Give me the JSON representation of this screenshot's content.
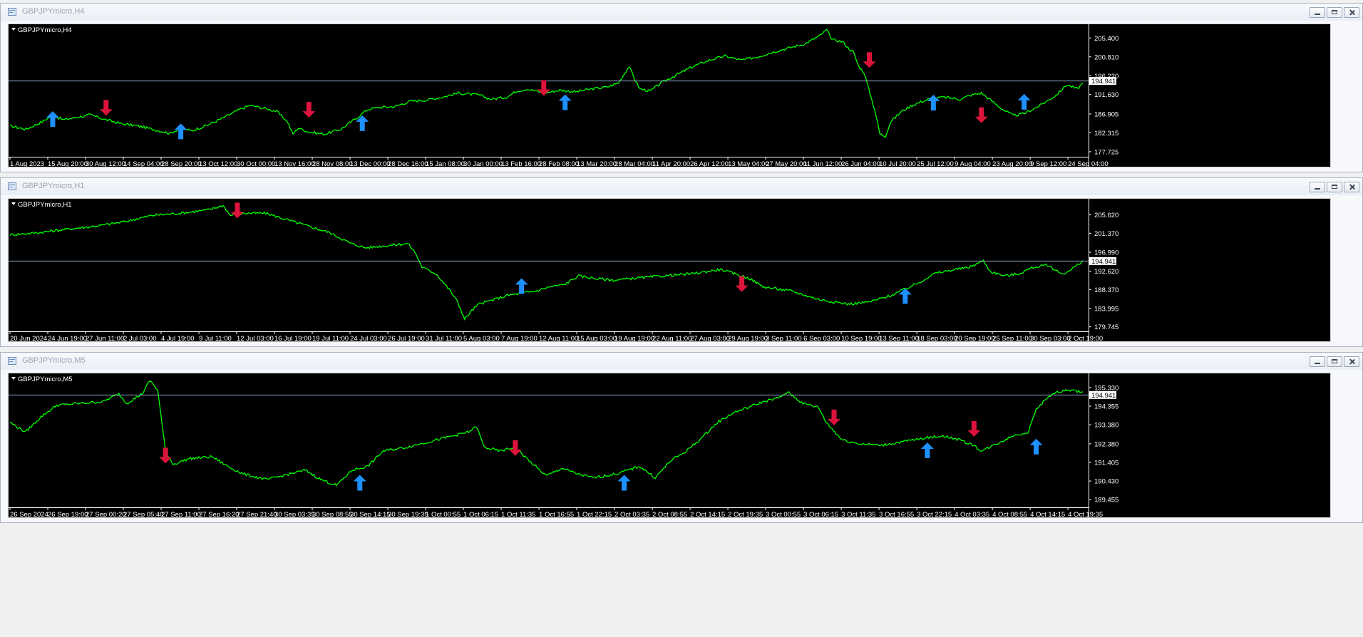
{
  "colors": {
    "background": "#000000",
    "price_line": "#00ff00",
    "axis_text": "#ffffff",
    "current_price_line": "#8fa8c8",
    "up_arrow": "#1e90ff",
    "down_arrow": "#dc143c"
  },
  "windows": [
    {
      "title": "GBPJPYmicro,H4",
      "chart_label": "GBPJPYmicro,H4",
      "current_price": "194.941",
      "price_ticks": [
        "205.400",
        "200.810",
        "196.220",
        "191.630",
        "186.905",
        "182.315",
        "177.725"
      ],
      "time_labels": [
        "1 Aug 2023",
        "15 Aug 20:00",
        "30 Aug 12:00",
        "14 Sep 04:00",
        "28 Sep 20:00",
        "13 Oct 12:00",
        "30 Oct 00:00",
        "13 Nov 16:00",
        "28 Nov 08:00",
        "13 Dec 00:00",
        "28 Dec 16:00",
        "15 Jan 08:00",
        "30 Jan 00:00",
        "13 Feb 16:00",
        "28 Feb 08:00",
        "13 Mar 20:00",
        "28 Mar 04:00",
        "11 Apr 20:00",
        "26 Apr 12:00",
        "13 May 04:00",
        "27 May 20:00",
        "11 Jun 12:00",
        "26 Jun 04:00",
        "10 Jul 20:00",
        "25 Jul 12:00",
        "9 Aug 04:00",
        "23 Aug 20:00",
        "9 Sep 12:00",
        "24 Sep 04:00"
      ],
      "ylim": [
        176.5,
        208.4
      ],
      "series": [
        [
          0,
          184.0
        ],
        [
          3,
          183.2
        ],
        [
          6,
          185.0
        ],
        [
          8,
          186.6
        ],
        [
          10,
          185.5
        ],
        [
          13,
          186.2
        ],
        [
          15,
          186.7
        ],
        [
          18,
          185.5
        ],
        [
          21,
          184.5
        ],
        [
          24,
          184.0
        ],
        [
          27,
          183.1
        ],
        [
          30,
          182.2
        ],
        [
          32,
          183.5
        ],
        [
          34,
          182.8
        ],
        [
          37,
          184.2
        ],
        [
          40,
          186.0
        ],
        [
          43,
          188.0
        ],
        [
          45,
          189.0
        ],
        [
          48,
          188.2
        ],
        [
          50,
          187.5
        ],
        [
          52,
          185.0
        ],
        [
          53,
          182.0
        ],
        [
          54,
          183.5
        ],
        [
          56,
          182.5
        ],
        [
          59,
          182.0
        ],
        [
          62,
          183.2
        ],
        [
          65,
          186.0
        ],
        [
          67,
          188.0
        ],
        [
          69,
          188.5
        ],
        [
          72,
          188.7
        ],
        [
          75,
          190.0
        ],
        [
          78,
          190.3
        ],
        [
          81,
          191.0
        ],
        [
          84,
          192.0
        ],
        [
          88,
          191.5
        ],
        [
          90,
          190.5
        ],
        [
          93,
          191.0
        ],
        [
          95,
          192.5
        ],
        [
          97,
          193.0
        ],
        [
          100,
          192.0
        ],
        [
          103,
          192.7
        ],
        [
          106,
          192.3
        ],
        [
          109,
          193.0
        ],
        [
          112,
          193.5
        ],
        [
          114,
          194.5
        ],
        [
          116,
          198.5
        ],
        [
          117,
          195.5
        ],
        [
          118,
          193.0
        ],
        [
          120,
          192.5
        ],
        [
          122,
          194.5
        ],
        [
          125,
          196.5
        ],
        [
          128,
          198.5
        ],
        [
          131,
          200.0
        ],
        [
          134,
          201.0
        ],
        [
          137,
          200.0
        ],
        [
          140,
          200.8
        ],
        [
          143,
          202.0
        ],
        [
          146,
          203.0
        ],
        [
          149,
          204.0
        ],
        [
          152,
          206.2
        ],
        [
          153,
          207.4
        ],
        [
          154,
          205.0
        ],
        [
          156,
          204.5
        ],
        [
          157,
          203.0
        ],
        [
          158,
          202.0
        ],
        [
          159,
          198.5
        ],
        [
          160,
          197.0
        ],
        [
          162,
          188.0
        ],
        [
          163,
          182.0
        ],
        [
          164,
          181.5
        ],
        [
          165,
          185.0
        ],
        [
          167,
          187.5
        ],
        [
          169,
          189.0
        ],
        [
          172,
          190.5
        ],
        [
          175,
          191.0
        ],
        [
          178,
          190.5
        ],
        [
          180,
          191.5
        ],
        [
          182,
          192.0
        ],
        [
          184,
          190.0
        ],
        [
          186,
          188.0
        ],
        [
          188,
          186.5
        ],
        [
          190,
          187.0
        ],
        [
          193,
          189.0
        ],
        [
          196,
          191.5
        ],
        [
          198,
          194.0
        ],
        [
          200,
          193.0
        ],
        [
          201,
          194.5
        ]
      ],
      "up_arrows": [
        [
          8,
          185.5
        ],
        [
          32,
          182.5
        ],
        [
          66,
          184.5
        ],
        [
          104,
          189.6
        ],
        [
          173,
          189.5
        ],
        [
          190,
          189.7
        ]
      ],
      "down_arrows": [
        [
          18,
          188.6
        ],
        [
          56,
          188.1
        ],
        [
          100,
          193.4
        ],
        [
          161,
          200.2
        ],
        [
          182,
          186.8
        ]
      ]
    },
    {
      "title": "GBPJPYmicro,H1",
      "chart_label": "GBPJPYmicro,H1",
      "current_price": "194.941",
      "price_ticks": [
        "205.620",
        "201.370",
        "196.990",
        "192.620",
        "188.370",
        "183.995",
        "179.745"
      ],
      "time_labels": [
        "20 Jun 2024",
        "24 Jun 19:00",
        "27 Jun 11:00",
        "2 Jul 03:00",
        "4 Jul 19:00",
        "9 Jul 11:00",
        "12 Jul 03:00",
        "16 Jul 19:00",
        "19 Jul 11:00",
        "24 Jul 03:00",
        "26 Jul 19:00",
        "31 Jul 11:00",
        "5 Aug 03:00",
        "7 Aug 19:00",
        "12 Aug 11:00",
        "15 Aug 03:00",
        "19 Aug 19:00",
        "22 Aug 11:00",
        "27 Aug 03:00",
        "29 Aug 19:00",
        "3 Sep 11:00",
        "6 Sep 03:00",
        "10 Sep 19:00",
        "13 Sep 11:00",
        "18 Sep 03:00",
        "20 Sep 19:00",
        "25 Sep 11:00",
        "30 Sep 03:00",
        "2 Oct 19:00"
      ],
      "ylim": [
        178.7,
        209.0
      ],
      "series": [
        [
          0,
          201.0
        ],
        [
          4,
          201.5
        ],
        [
          8,
          202.3
        ],
        [
          12,
          203.0
        ],
        [
          16,
          204.0
        ],
        [
          20,
          205.5
        ],
        [
          24,
          206.0
        ],
        [
          28,
          206.8
        ],
        [
          30,
          207.8
        ],
        [
          31,
          205.5
        ],
        [
          33,
          206.0
        ],
        [
          36,
          206.0
        ],
        [
          39,
          204.5
        ],
        [
          42,
          203.0
        ],
        [
          45,
          201.5
        ],
        [
          48,
          199.0
        ],
        [
          50,
          198.0
        ],
        [
          53,
          198.5
        ],
        [
          56,
          199.0
        ],
        [
          57,
          197.0
        ],
        [
          58,
          193.5
        ],
        [
          60,
          192.0
        ],
        [
          62,
          188.0
        ],
        [
          63,
          185.5
        ],
        [
          64,
          181.5
        ],
        [
          65,
          183.5
        ],
        [
          66,
          185.0
        ],
        [
          68,
          186.0
        ],
        [
          70,
          187.0
        ],
        [
          72,
          187.5
        ],
        [
          74,
          188.0
        ],
        [
          76,
          189.0
        ],
        [
          78,
          189.5
        ],
        [
          80,
          191.5
        ],
        [
          82,
          191.0
        ],
        [
          85,
          190.5
        ],
        [
          88,
          191.0
        ],
        [
          92,
          191.5
        ],
        [
          96,
          192.0
        ],
        [
          100,
          193.0
        ],
        [
          102,
          192.0
        ],
        [
          104,
          191.0
        ],
        [
          106,
          189.0
        ],
        [
          110,
          188.0
        ],
        [
          114,
          186.0
        ],
        [
          118,
          185.0
        ],
        [
          121,
          185.5
        ],
        [
          124,
          187.0
        ],
        [
          126,
          188.5
        ],
        [
          128,
          190.0
        ],
        [
          130,
          192.0
        ],
        [
          133,
          193.0
        ],
        [
          135,
          193.5
        ],
        [
          137,
          195.0
        ],
        [
          138,
          192.5
        ],
        [
          140,
          191.5
        ],
        [
          142,
          192.0
        ],
        [
          144,
          193.5
        ],
        [
          146,
          194.0
        ],
        [
          148,
          192.0
        ],
        [
          149,
          192.5
        ],
        [
          151,
          195.0
        ]
      ],
      "up_arrows": [
        [
          72,
          189.0
        ],
        [
          126,
          186.7
        ]
      ],
      "down_arrows": [
        [
          32,
          206.8
        ],
        [
          103,
          189.8
        ]
      ]
    },
    {
      "title": "GBPJPYmicro,M5",
      "chart_label": "GBPJPYmicro,M5",
      "current_price": "194.941",
      "price_ticks": [
        "195.330",
        "194.355",
        "193.380",
        "192.380",
        "191.405",
        "190.430",
        "189.455"
      ],
      "time_labels": [
        "26 Sep 2024",
        "26 Sep 19:00",
        "27 Sep 00:20",
        "27 Sep 05:40",
        "27 Sep 11:00",
        "27 Sep 16:20",
        "27 Sep 21:40",
        "30 Sep 03:35",
        "30 Sep 08:55",
        "30 Sep 14:15",
        "30 Sep 19:35",
        "1 Oct 00:55",
        "1 Oct 06:15",
        "1 Oct 11:35",
        "1 Oct 16:55",
        "1 Oct 22:15",
        "2 Oct 03:35",
        "2 Oct 08:55",
        "2 Oct 14:15",
        "2 Oct 19:35",
        "3 Oct 00:55",
        "3 Oct 06:15",
        "3 Oct 11:35",
        "3 Oct 16:55",
        "3 Oct 22:15",
        "4 Oct 03:35",
        "4 Oct 08:55",
        "4 Oct 14:15",
        "4 Oct 19:35"
      ],
      "ylim": [
        189.05,
        196.0
      ],
      "series": [
        [
          0,
          193.5
        ],
        [
          2,
          193.0
        ],
        [
          4,
          193.8
        ],
        [
          6,
          194.4
        ],
        [
          9,
          194.5
        ],
        [
          12,
          194.6
        ],
        [
          14,
          195.0
        ],
        [
          15,
          194.5
        ],
        [
          17,
          195.0
        ],
        [
          18,
          195.7
        ],
        [
          19,
          195.2
        ],
        [
          20,
          192.0
        ],
        [
          21,
          191.3
        ],
        [
          23,
          191.6
        ],
        [
          26,
          191.7
        ],
        [
          28,
          191.2
        ],
        [
          30,
          190.8
        ],
        [
          33,
          190.5
        ],
        [
          36,
          190.8
        ],
        [
          38,
          191.0
        ],
        [
          40,
          190.5
        ],
        [
          42,
          190.2
        ],
        [
          44,
          191.0
        ],
        [
          46,
          191.2
        ],
        [
          48,
          192.0
        ],
        [
          51,
          192.2
        ],
        [
          53,
          192.4
        ],
        [
          56,
          192.7
        ],
        [
          59,
          193.0
        ],
        [
          60,
          193.3
        ],
        [
          61,
          192.2
        ],
        [
          63,
          192.0
        ],
        [
          65,
          192.2
        ],
        [
          67,
          191.4
        ],
        [
          69,
          190.7
        ],
        [
          71,
          191.1
        ],
        [
          73,
          190.8
        ],
        [
          75,
          190.6
        ],
        [
          78,
          190.8
        ],
        [
          81,
          191.2
        ],
        [
          83,
          190.6
        ],
        [
          85,
          191.5
        ],
        [
          87,
          192.0
        ],
        [
          89,
          192.7
        ],
        [
          91,
          193.5
        ],
        [
          93,
          194.0
        ],
        [
          95,
          194.3
        ],
        [
          97,
          194.6
        ],
        [
          99,
          194.8
        ],
        [
          100,
          195.1
        ],
        [
          102,
          194.5
        ],
        [
          104,
          194.3
        ],
        [
          105,
          193.5
        ],
        [
          107,
          192.6
        ],
        [
          109,
          192.4
        ],
        [
          112,
          192.3
        ],
        [
          115,
          192.5
        ],
        [
          118,
          192.7
        ],
        [
          120,
          192.8
        ],
        [
          122,
          192.6
        ],
        [
          124,
          192.3
        ],
        [
          125,
          192.0
        ],
        [
          127,
          192.4
        ],
        [
          129,
          192.8
        ],
        [
          131,
          193.0
        ],
        [
          132,
          194.2
        ],
        [
          134,
          195.0
        ],
        [
          136,
          195.2
        ],
        [
          138,
          195.1
        ]
      ],
      "up_arrows": [
        [
          45,
          190.3
        ],
        [
          79,
          190.3
        ],
        [
          118,
          192.0
        ],
        [
          132,
          192.2
        ]
      ],
      "down_arrows": [
        [
          20,
          191.8
        ],
        [
          65,
          192.2
        ],
        [
          106,
          193.8
        ],
        [
          124,
          193.2
        ]
      ]
    }
  ]
}
